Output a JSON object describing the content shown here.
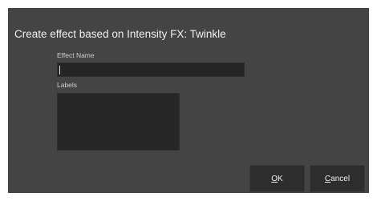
{
  "dialog": {
    "title": "Create effect based on Intensity FX: Twinkle",
    "background": "#444444"
  },
  "form": {
    "effect_name_label": "Effect Name",
    "effect_name_value": "",
    "labels_label": "Labels",
    "labels_value": ""
  },
  "buttons": {
    "ok": {
      "mnemonic": "O",
      "rest": "K"
    },
    "cancel": {
      "mnemonic": "C",
      "rest": "ancel"
    }
  }
}
